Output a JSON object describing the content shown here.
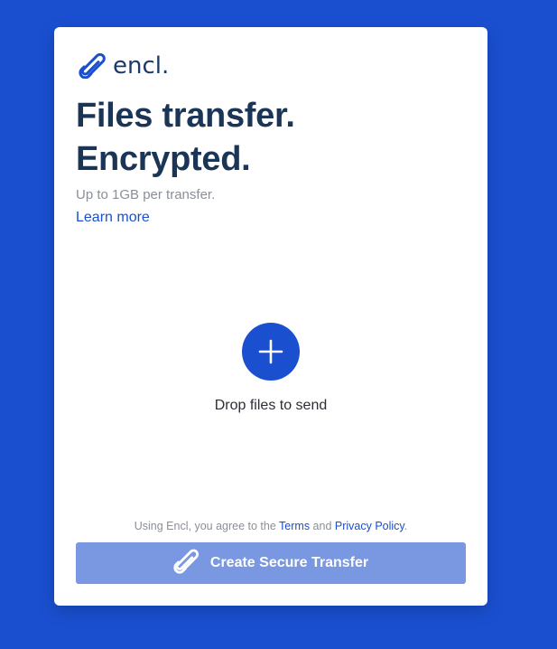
{
  "brand": {
    "name": "encl.",
    "logo_icon": "paperclip-icon"
  },
  "hero": {
    "line1": "Files transfer.",
    "line2": "Encrypted.",
    "subtitle": "Up to 1GB per transfer.",
    "learn_more": "Learn more"
  },
  "drop": {
    "icon": "plus-icon",
    "label": "Drop files to send"
  },
  "legal": {
    "prefix": "Using Encl, you agree to the ",
    "terms": "Terms",
    "middle": " and ",
    "privacy": "Privacy Policy",
    "suffix": "."
  },
  "action": {
    "icon": "paperclip-icon",
    "label": "Create Secure Transfer"
  },
  "colors": {
    "background": "#1a4fd0",
    "card": "#ffffff",
    "heading": "#1b3556",
    "accent": "#1a4fd0",
    "button_disabled": "#7a97e2",
    "muted": "#8a8f98"
  }
}
